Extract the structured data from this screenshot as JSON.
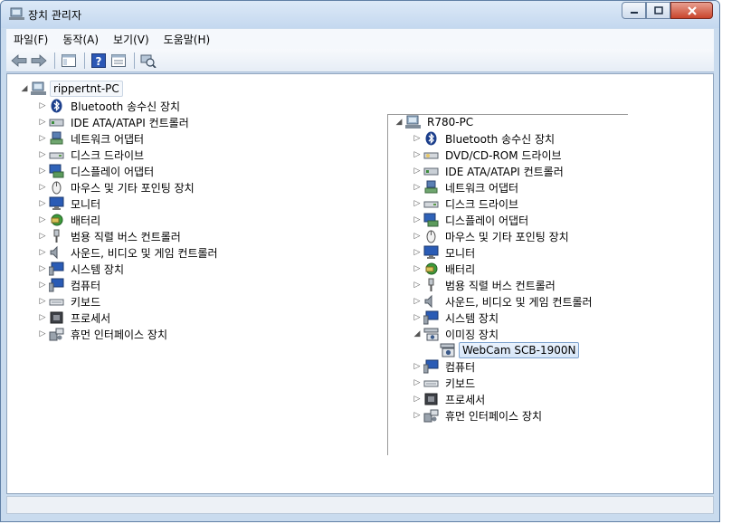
{
  "window": {
    "title": "장치 관리자"
  },
  "menu": [
    {
      "label": "파일(F)"
    },
    {
      "label": "동작(A)"
    },
    {
      "label": "보기(V)"
    },
    {
      "label": "도움말(H)"
    }
  ],
  "toolbar": {
    "buttons": [
      "back-arrow-icon",
      "forward-arrow-icon",
      "show-hide-console-tree-icon",
      "help-icon",
      "properties-icon",
      "scan-hardware-icon"
    ]
  },
  "left_tree": {
    "root": "rippertnt-PC",
    "items": [
      {
        "label": "Bluetooth 송수신 장치",
        "icon": "bluetooth-icon"
      },
      {
        "label": "IDE ATA/ATAPI 컨트롤러",
        "icon": "ide-controller-icon"
      },
      {
        "label": "네트워크 어댑터",
        "icon": "network-adapter-icon"
      },
      {
        "label": "디스크 드라이브",
        "icon": "disk-drive-icon"
      },
      {
        "label": "디스플레이 어댑터",
        "icon": "display-adapter-icon"
      },
      {
        "label": "마우스 및 기타 포인팅 장치",
        "icon": "mouse-icon"
      },
      {
        "label": "모니터",
        "icon": "monitor-icon"
      },
      {
        "label": "배터리",
        "icon": "battery-icon"
      },
      {
        "label": "범용 직렬 버스 컨트롤러",
        "icon": "usb-icon"
      },
      {
        "label": "사운드, 비디오 및 게임 컨트롤러",
        "icon": "sound-icon"
      },
      {
        "label": "시스템 장치",
        "icon": "system-device-icon"
      },
      {
        "label": "컴퓨터",
        "icon": "computer-icon"
      },
      {
        "label": "키보드",
        "icon": "keyboard-icon"
      },
      {
        "label": "프로세서",
        "icon": "processor-icon"
      },
      {
        "label": "휴먼 인터페이스 장치",
        "icon": "hid-icon"
      }
    ]
  },
  "right_tree": {
    "root": "R780-PC",
    "items": [
      {
        "label": "Bluetooth 송수신 장치",
        "icon": "bluetooth-icon"
      },
      {
        "label": "DVD/CD-ROM 드라이브",
        "icon": "dvd-drive-icon"
      },
      {
        "label": "IDE ATA/ATAPI 컨트롤러",
        "icon": "ide-controller-icon"
      },
      {
        "label": "네트워크 어댑터",
        "icon": "network-adapter-icon"
      },
      {
        "label": "디스크 드라이브",
        "icon": "disk-drive-icon"
      },
      {
        "label": "디스플레이 어댑터",
        "icon": "display-adapter-icon"
      },
      {
        "label": "마우스 및 기타 포인팅 장치",
        "icon": "mouse-icon"
      },
      {
        "label": "모니터",
        "icon": "monitor-icon"
      },
      {
        "label": "배터리",
        "icon": "battery-icon"
      },
      {
        "label": "범용 직렬 버스 컨트롤러",
        "icon": "usb-icon"
      },
      {
        "label": "사운드, 비디오 및 게임 컨트롤러",
        "icon": "sound-icon"
      },
      {
        "label": "시스템 장치",
        "icon": "system-device-icon"
      },
      {
        "label": "이미징 장치",
        "icon": "imaging-device-icon",
        "expanded": true
      },
      {
        "label": "WebCam SCB-1900N",
        "icon": "webcam-icon",
        "child": true,
        "selected": true
      },
      {
        "label": "컴퓨터",
        "icon": "computer-icon"
      },
      {
        "label": "키보드",
        "icon": "keyboard-icon"
      },
      {
        "label": "프로세서",
        "icon": "processor-icon"
      },
      {
        "label": "휴먼 인터페이스 장치",
        "icon": "hid-icon"
      }
    ]
  }
}
